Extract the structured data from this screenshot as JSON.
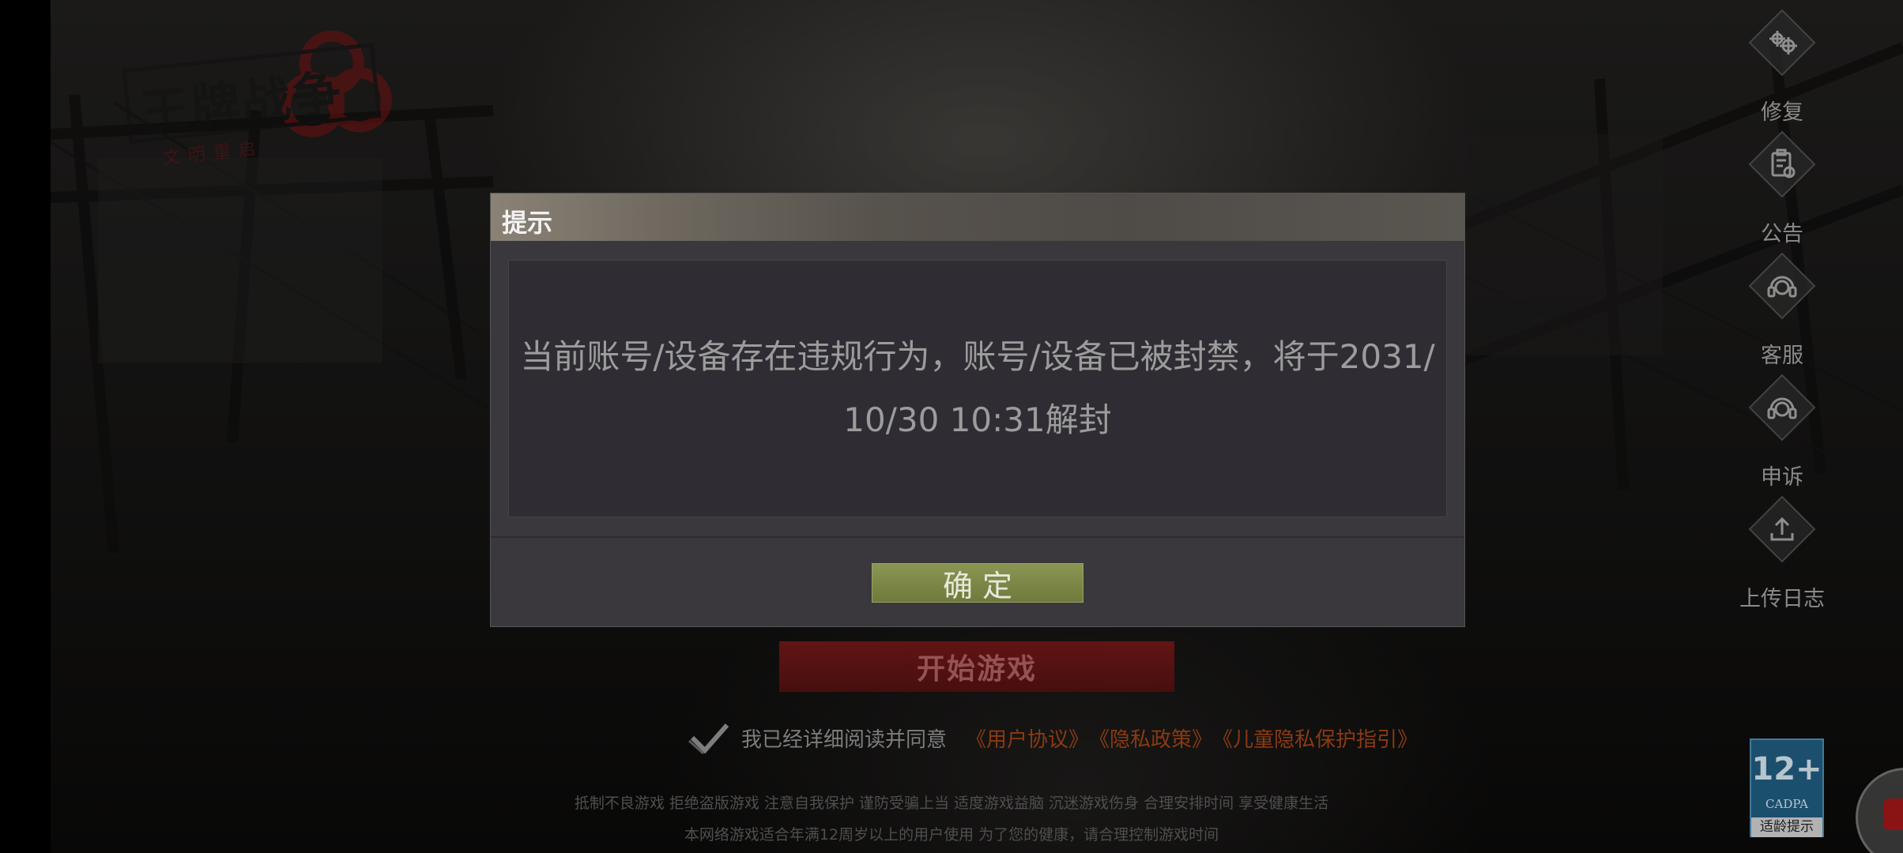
{
  "logo": {
    "title": "王牌战争",
    "subtitle": "文明重启"
  },
  "side_menu": [
    {
      "label": "修复",
      "icon": "gear-icon"
    },
    {
      "label": "公告",
      "icon": "announcement-icon"
    },
    {
      "label": "客服",
      "icon": "headset-icon"
    },
    {
      "label": "申诉",
      "icon": "headset-icon"
    },
    {
      "label": "上传日志",
      "icon": "upload-icon"
    }
  ],
  "start_button": {
    "label": "开始游戏"
  },
  "agreement": {
    "text": "我已经详细阅读并同意",
    "links": [
      "《用户协议》",
      "《隐私政策》",
      "《儿童隐私保护指引》"
    ]
  },
  "footer": {
    "line1": "抵制不良游戏 拒绝盗版游戏 注意自我保护 谨防受骗上当 适度游戏益脑 沉迷游戏伤身 合理安排时间 享受健康生活",
    "line2": "本网络游戏适合年满12周岁以上的用户使用    为了您的健康，请合理控制游戏时间"
  },
  "age_rating": {
    "number": "12+",
    "org": "CADPA",
    "tip": "适龄提示"
  },
  "dialog": {
    "title": "提示",
    "message": "当前账号/设备存在违规行为，账号/设备已被封禁，将于2031/10/30 10:31解封",
    "confirm_label": "确定"
  },
  "colors": {
    "confirm_button": "#7a8646",
    "start_button": "#5a1010",
    "link": "#8a3a12",
    "age_badge": "#1f5c80"
  }
}
